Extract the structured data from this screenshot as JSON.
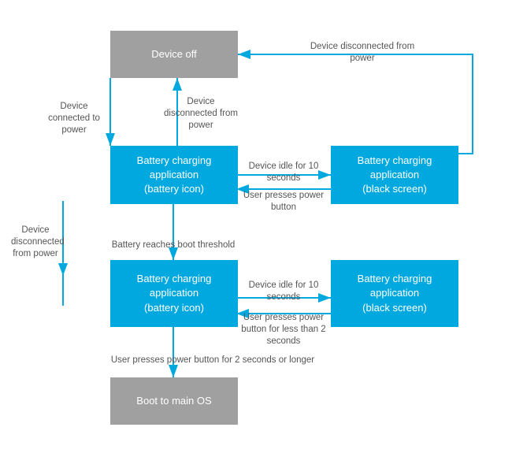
{
  "boxes": {
    "device_off": {
      "label": "Device off"
    },
    "bca_battery_top": {
      "label": "Battery charging\napplication\n(battery icon)"
    },
    "bca_black_top": {
      "label": "Battery charging\napplication\n(black screen)"
    },
    "bca_battery_bottom": {
      "label": "Battery charging\napplication\n(battery icon)"
    },
    "bca_black_bottom": {
      "label": "Battery charging\napplication\n(black screen)"
    },
    "boot_main": {
      "label": "Boot to main OS"
    }
  },
  "arrows": {
    "connected_to_power": "Device connected\nto power",
    "disconnected_top": "Device disconnected\nfrom power",
    "disconnected_right": "Device disconnected from power",
    "idle_10_top": "Device idle for 10 seconds",
    "power_button_top": "User presses power button",
    "disconnected_left": "Device disconnected\nfrom power",
    "boot_threshold": "Battery reaches boot threshold",
    "idle_10_bottom": "Device idle for 10 seconds",
    "power_button_bottom": "User presses power button\nfor less than 2 seconds",
    "power_2sec": "User presses power button for 2 seconds or longer"
  }
}
